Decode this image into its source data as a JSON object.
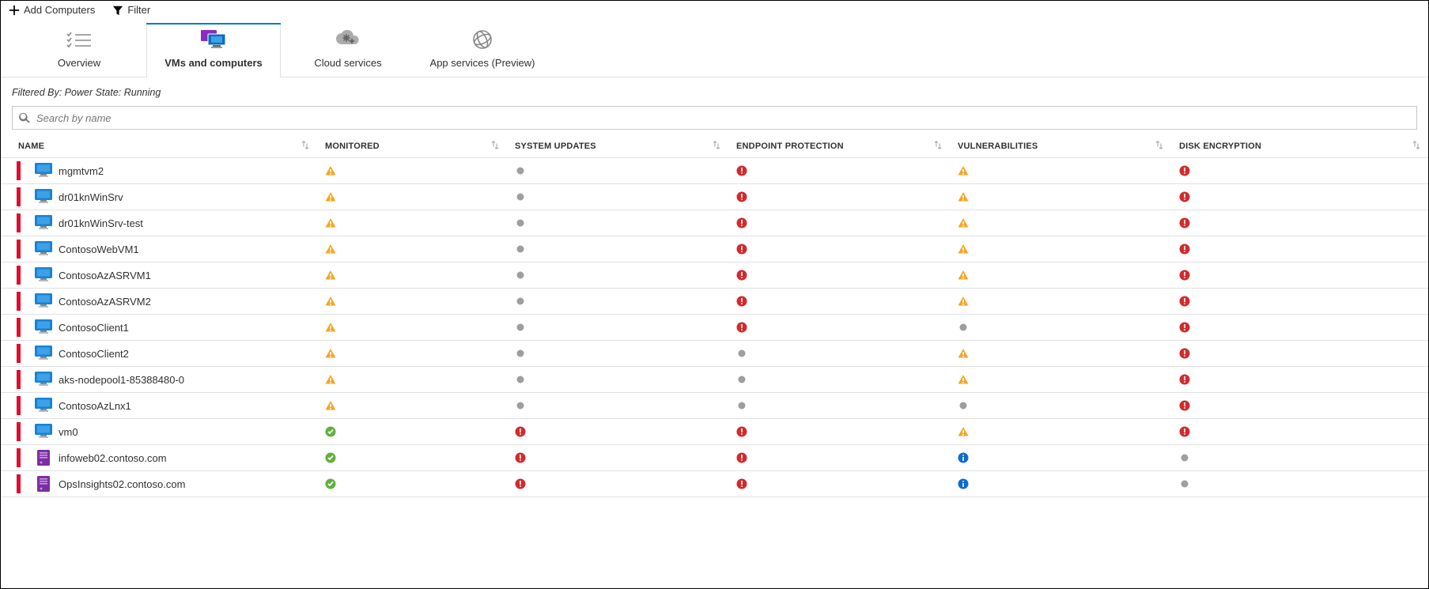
{
  "toolbar": {
    "add_label": "Add Computers",
    "filter_label": "Filter"
  },
  "tabs": [
    {
      "key": "overview",
      "label": "Overview",
      "icon": "checklist"
    },
    {
      "key": "vms",
      "label": "VMs and computers",
      "icon": "vms",
      "active": true
    },
    {
      "key": "cloud",
      "label": "Cloud services",
      "icon": "cloud"
    },
    {
      "key": "apps",
      "label": "App services (Preview)",
      "icon": "globe"
    }
  ],
  "filtered_by": "Filtered By: Power State: Running",
  "search": {
    "placeholder": "Search by name"
  },
  "columns": [
    {
      "key": "name",
      "label": "NAME"
    },
    {
      "key": "monitored",
      "label": "MONITORED"
    },
    {
      "key": "updates",
      "label": "SYSTEM UPDATES"
    },
    {
      "key": "endpoint",
      "label": "ENDPOINT PROTECTION"
    },
    {
      "key": "vuln",
      "label": "VULNERABILITIES"
    },
    {
      "key": "disk",
      "label": "DISK ENCRYPTION"
    }
  ],
  "rows": [
    {
      "severity": "high",
      "type": "vm",
      "name": "mgmtvm2",
      "monitored": "warn",
      "updates": "none",
      "endpoint": "err",
      "vuln": "warn",
      "disk": "err"
    },
    {
      "severity": "high",
      "type": "vm",
      "name": "dr01knWinSrv",
      "monitored": "warn",
      "updates": "none",
      "endpoint": "err",
      "vuln": "warn",
      "disk": "err"
    },
    {
      "severity": "high",
      "type": "vm",
      "name": "dr01knWinSrv-test",
      "monitored": "warn",
      "updates": "none",
      "endpoint": "err",
      "vuln": "warn",
      "disk": "err"
    },
    {
      "severity": "high",
      "type": "vm",
      "name": "ContosoWebVM1",
      "monitored": "warn",
      "updates": "none",
      "endpoint": "err",
      "vuln": "warn",
      "disk": "err"
    },
    {
      "severity": "high",
      "type": "vm",
      "name": "ContosoAzASRVM1",
      "monitored": "warn",
      "updates": "none",
      "endpoint": "err",
      "vuln": "warn",
      "disk": "err"
    },
    {
      "severity": "high",
      "type": "vm",
      "name": "ContosoAzASRVM2",
      "monitored": "warn",
      "updates": "none",
      "endpoint": "err",
      "vuln": "warn",
      "disk": "err"
    },
    {
      "severity": "high",
      "type": "vm",
      "name": "ContosoClient1",
      "monitored": "warn",
      "updates": "none",
      "endpoint": "err",
      "vuln": "none",
      "disk": "err"
    },
    {
      "severity": "high",
      "type": "vm",
      "name": "ContosoClient2",
      "monitored": "warn",
      "updates": "none",
      "endpoint": "none",
      "vuln": "warn",
      "disk": "err"
    },
    {
      "severity": "high",
      "type": "vm",
      "name": "aks-nodepool1-85388480-0",
      "monitored": "warn",
      "updates": "none",
      "endpoint": "none",
      "vuln": "warn",
      "disk": "err"
    },
    {
      "severity": "high",
      "type": "vm",
      "name": "ContosoAzLnx1",
      "monitored": "warn",
      "updates": "none",
      "endpoint": "none",
      "vuln": "none",
      "disk": "err"
    },
    {
      "severity": "high",
      "type": "vm",
      "name": "vm0",
      "monitored": "ok",
      "updates": "err",
      "endpoint": "err",
      "vuln": "warn",
      "disk": "err"
    },
    {
      "severity": "high",
      "type": "server",
      "name": "infoweb02.contoso.com",
      "monitored": "ok",
      "updates": "err",
      "endpoint": "err",
      "vuln": "info",
      "disk": "none"
    },
    {
      "severity": "high",
      "type": "server",
      "name": "OpsInsights02.contoso.com",
      "monitored": "ok",
      "updates": "err",
      "endpoint": "err",
      "vuln": "info",
      "disk": "none"
    }
  ]
}
